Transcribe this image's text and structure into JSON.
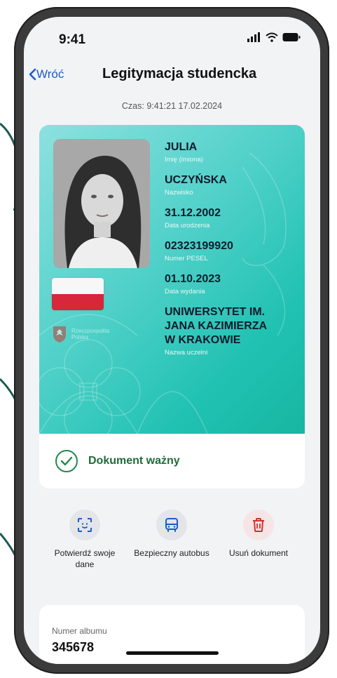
{
  "status_bar": {
    "time": "9:41"
  },
  "nav": {
    "back_label": "Wróć",
    "title": "Legitymacja studencka"
  },
  "timestamp": "Czas: 9:41:21 17.02.2024",
  "card": {
    "fields": [
      {
        "value": "JULIA",
        "label": "Imię (imiona)"
      },
      {
        "value": "UCZYŃSKA",
        "label": "Nazwisko"
      },
      {
        "value": "31.12.2002",
        "label": "Data urodzenia"
      },
      {
        "value": "02323199920",
        "label": "Numer PESEL"
      },
      {
        "value": "01.10.2023",
        "label": "Data wydania"
      },
      {
        "value": "UNIWERSYTET IM. JANA KAZIMIERZA W KRAKOWIE",
        "label": "Nazwa uczelni"
      }
    ],
    "emblem_label": "Rzeczpospolita Polska",
    "flag_colors": [
      "#f7f7f7",
      "#d8263b"
    ],
    "gradient_colors": [
      "#8de1df",
      "#17b6a2"
    ]
  },
  "document_status": {
    "text": "Dokument ważny",
    "color": "#1f6b3a"
  },
  "actions": [
    {
      "label": "Potwierdź swoje dane",
      "icon": "scan-face-icon"
    },
    {
      "label": "Bezpieczny autobus",
      "icon": "bus-icon"
    },
    {
      "label": "Usuń dokument",
      "icon": "trash-icon"
    }
  ],
  "album": {
    "label": "Numer albumu",
    "value": "345678"
  }
}
